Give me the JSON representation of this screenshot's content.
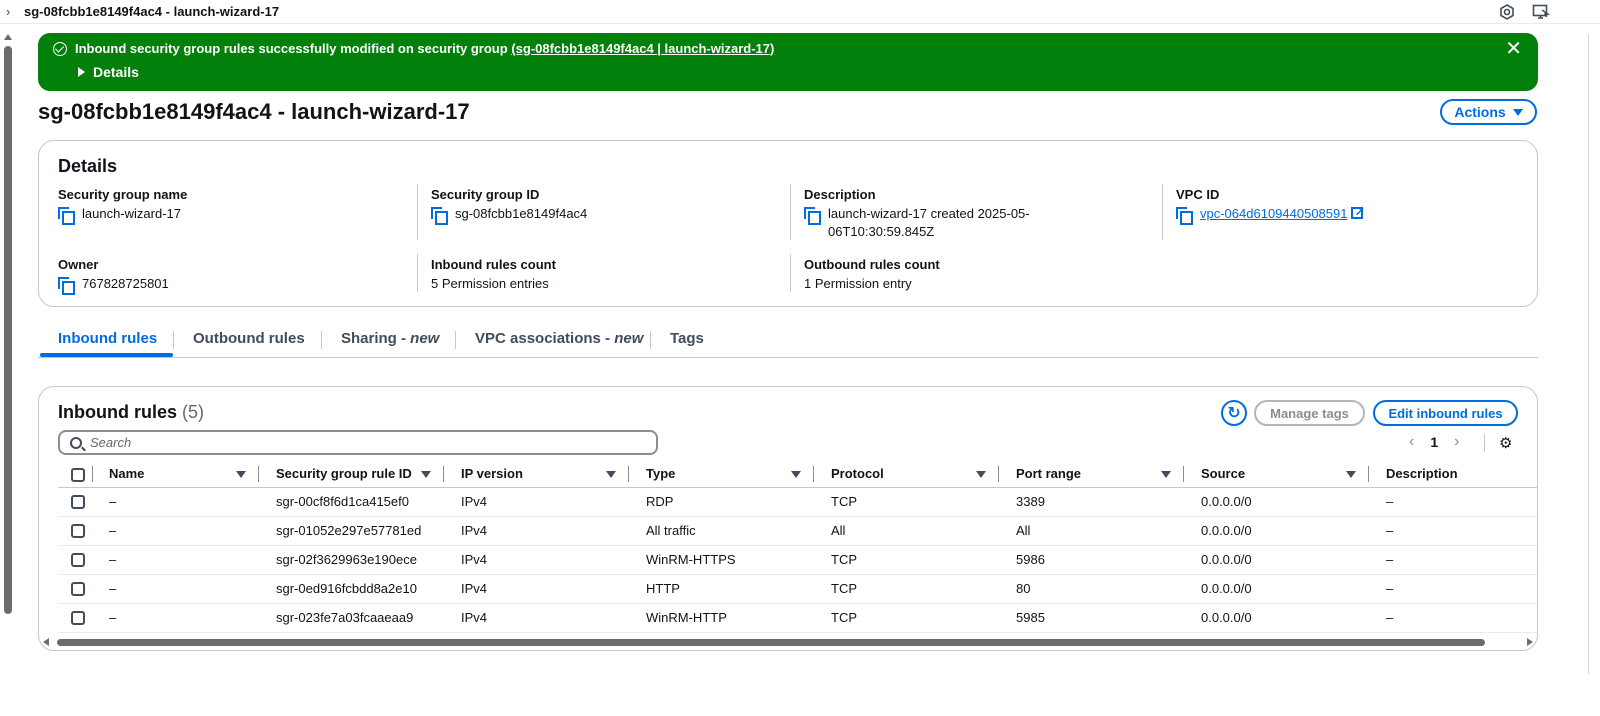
{
  "topbar": {
    "title": "sg-08fcbb1e8149f4ac4 - launch-wizard-17"
  },
  "flash": {
    "message": "Inbound security group rules successfully modified on security group",
    "link_text": "(sg-08fcbb1e8149f4ac4 | launch-wizard-17)",
    "details_label": "Details",
    "close_glyph": "✕",
    "color": "#037f0c"
  },
  "page": {
    "title": "sg-08fcbb1e8149f4ac4 - launch-wizard-17",
    "actions_label": "Actions"
  },
  "details": {
    "heading": "Details",
    "security_group_name": {
      "label": "Security group name",
      "value": "launch-wizard-17"
    },
    "security_group_id": {
      "label": "Security group ID",
      "value": "sg-08fcbb1e8149f4ac4"
    },
    "description": {
      "label": "Description",
      "value": "launch-wizard-17 created 2025-05-06T10:30:59.845Z"
    },
    "vpc_id": {
      "label": "VPC ID",
      "value": "vpc-064d6109440508591"
    },
    "owner": {
      "label": "Owner",
      "value": "767828725801"
    },
    "inbound_rules_count": {
      "label": "Inbound rules count",
      "value": "5 Permission entries"
    },
    "outbound_rules_count": {
      "label": "Outbound rules count",
      "value": "1 Permission entry"
    }
  },
  "tabs": [
    {
      "label": "Inbound rules",
      "suffix": ""
    },
    {
      "label": "Outbound rules",
      "suffix": ""
    },
    {
      "label": "Sharing - ",
      "suffix": "new"
    },
    {
      "label": "VPC associations - ",
      "suffix": "new"
    },
    {
      "label": "Tags",
      "suffix": ""
    }
  ],
  "inbound": {
    "heading": "Inbound rules",
    "count": "(5)",
    "manage_tags_label": "Manage tags",
    "edit_label": "Edit inbound rules",
    "search_placeholder": "Search",
    "page_number": "1",
    "columns": [
      "Name",
      "Security group rule ID",
      "IP version",
      "Type",
      "Protocol",
      "Port range",
      "Source",
      "Description"
    ],
    "rows": [
      {
        "name": "–",
        "rule_id": "sgr-00cf8f6d1ca415ef0",
        "ip_version": "IPv4",
        "type": "RDP",
        "protocol": "TCP",
        "port_range": "3389",
        "source": "0.0.0.0/0",
        "description": "–"
      },
      {
        "name": "–",
        "rule_id": "sgr-01052e297e57781ed",
        "ip_version": "IPv4",
        "type": "All traffic",
        "protocol": "All",
        "port_range": "All",
        "source": "0.0.0.0/0",
        "description": "–"
      },
      {
        "name": "–",
        "rule_id": "sgr-02f3629963e190ece",
        "ip_version": "IPv4",
        "type": "WinRM-HTTPS",
        "protocol": "TCP",
        "port_range": "5986",
        "source": "0.0.0.0/0",
        "description": "–"
      },
      {
        "name": "–",
        "rule_id": "sgr-0ed916fcbdd8a2e10",
        "ip_version": "IPv4",
        "type": "HTTP",
        "protocol": "TCP",
        "port_range": "80",
        "source": "0.0.0.0/0",
        "description": "–"
      },
      {
        "name": "–",
        "rule_id": "sgr-023fe7a03fcaaeaa9",
        "ip_version": "IPv4",
        "type": "WinRM-HTTP",
        "protocol": "TCP",
        "port_range": "5985",
        "source": "0.0.0.0/0",
        "description": "–"
      }
    ]
  },
  "colors": {
    "accent": "#006ce0",
    "success": "#037f0c",
    "text": "#0f141a"
  }
}
